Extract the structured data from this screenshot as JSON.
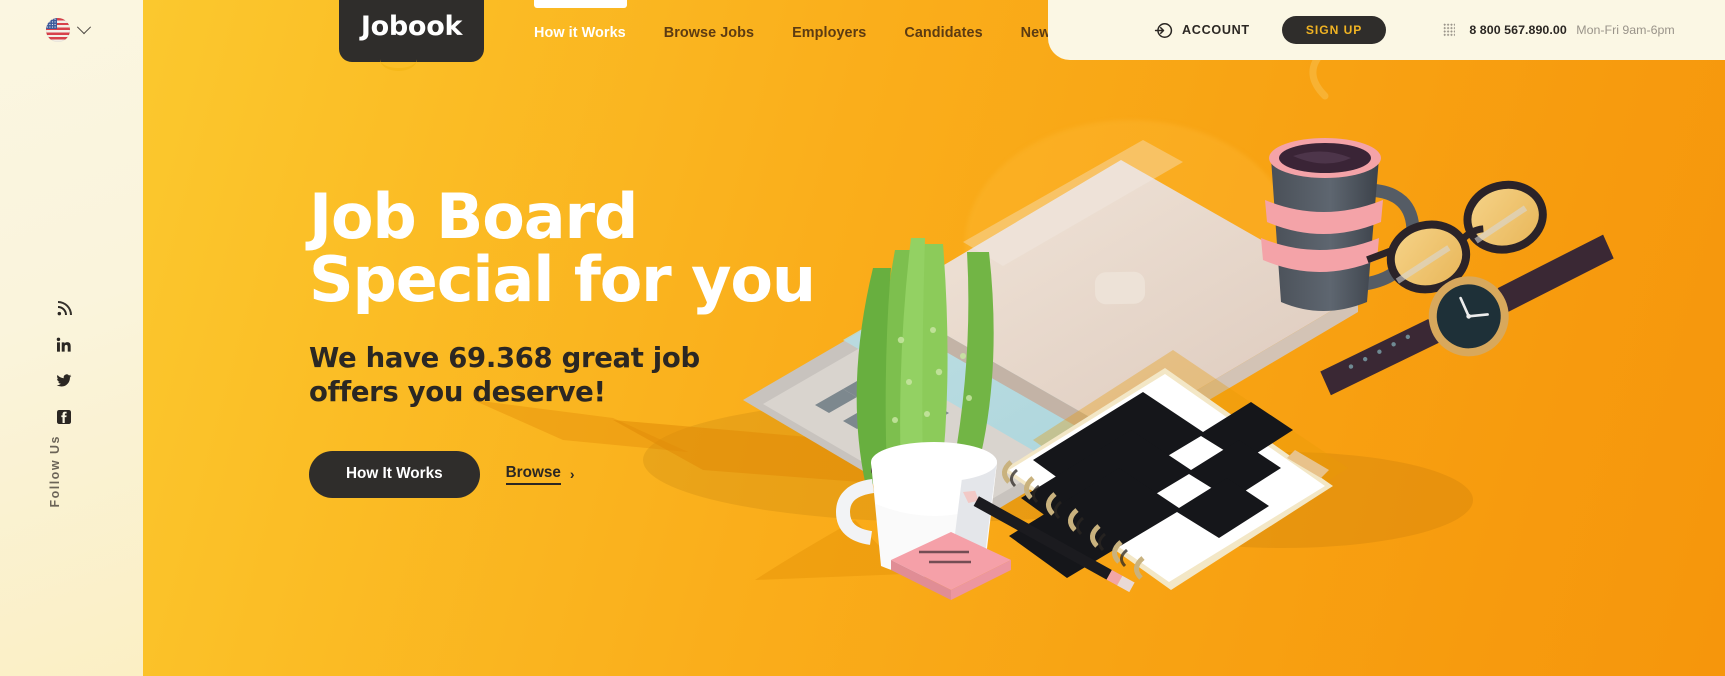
{
  "brand": {
    "name": "Jobook",
    "logo_icon": "jobook-smile-logo"
  },
  "language": {
    "current": "US",
    "flag_icon": "us-flag-icon",
    "chevron_icon": "chevron-down-icon"
  },
  "nav": {
    "items": [
      {
        "label": "How it Works",
        "active": true
      },
      {
        "label": "Browse Jobs",
        "active": false
      },
      {
        "label": "Employers",
        "active": false
      },
      {
        "label": "Candidates",
        "active": false
      },
      {
        "label": "News",
        "active": false
      }
    ]
  },
  "header": {
    "account_label": "ACCOUNT",
    "account_icon": "login-arrow-icon",
    "signup_label": "SIGN UP",
    "grid_icon": "dot-grid-icon",
    "phone_number": "8 800 567.890.00",
    "phone_hours": "Mon-Fri 9am-6pm"
  },
  "hero": {
    "title_line1": "Job Board",
    "title_line2": "Special for you",
    "subtitle_line1": "We have 69.368 great job",
    "subtitle_line2": "offers you deserve!",
    "primary_cta": "How It Works",
    "secondary_cta": "Browse",
    "secondary_cta_icon": "chevron-right-icon",
    "job_count": "69.368"
  },
  "social": {
    "follow_label": "Follow Us",
    "items": [
      {
        "name": "rss-icon",
        "label": "RSS"
      },
      {
        "name": "linkedin-icon",
        "label": "LinkedIn"
      },
      {
        "name": "twitter-icon",
        "label": "Twitter"
      },
      {
        "name": "facebook-icon",
        "label": "Facebook"
      }
    ]
  },
  "illustration": {
    "objects": [
      "laptop",
      "aloe-plant-in-mug",
      "coffee-mug",
      "eyeglasses",
      "wristwatch",
      "chevron-notebook",
      "pencil",
      "sticky-notes"
    ]
  },
  "colors": {
    "gradient_left": "#FBC82E",
    "gradient_right": "#F6960C",
    "ink": "#2F2D2B",
    "cream": "#FBF7E4",
    "accent_yellow": "#F0B323",
    "nav_text": "#5C3B12"
  }
}
